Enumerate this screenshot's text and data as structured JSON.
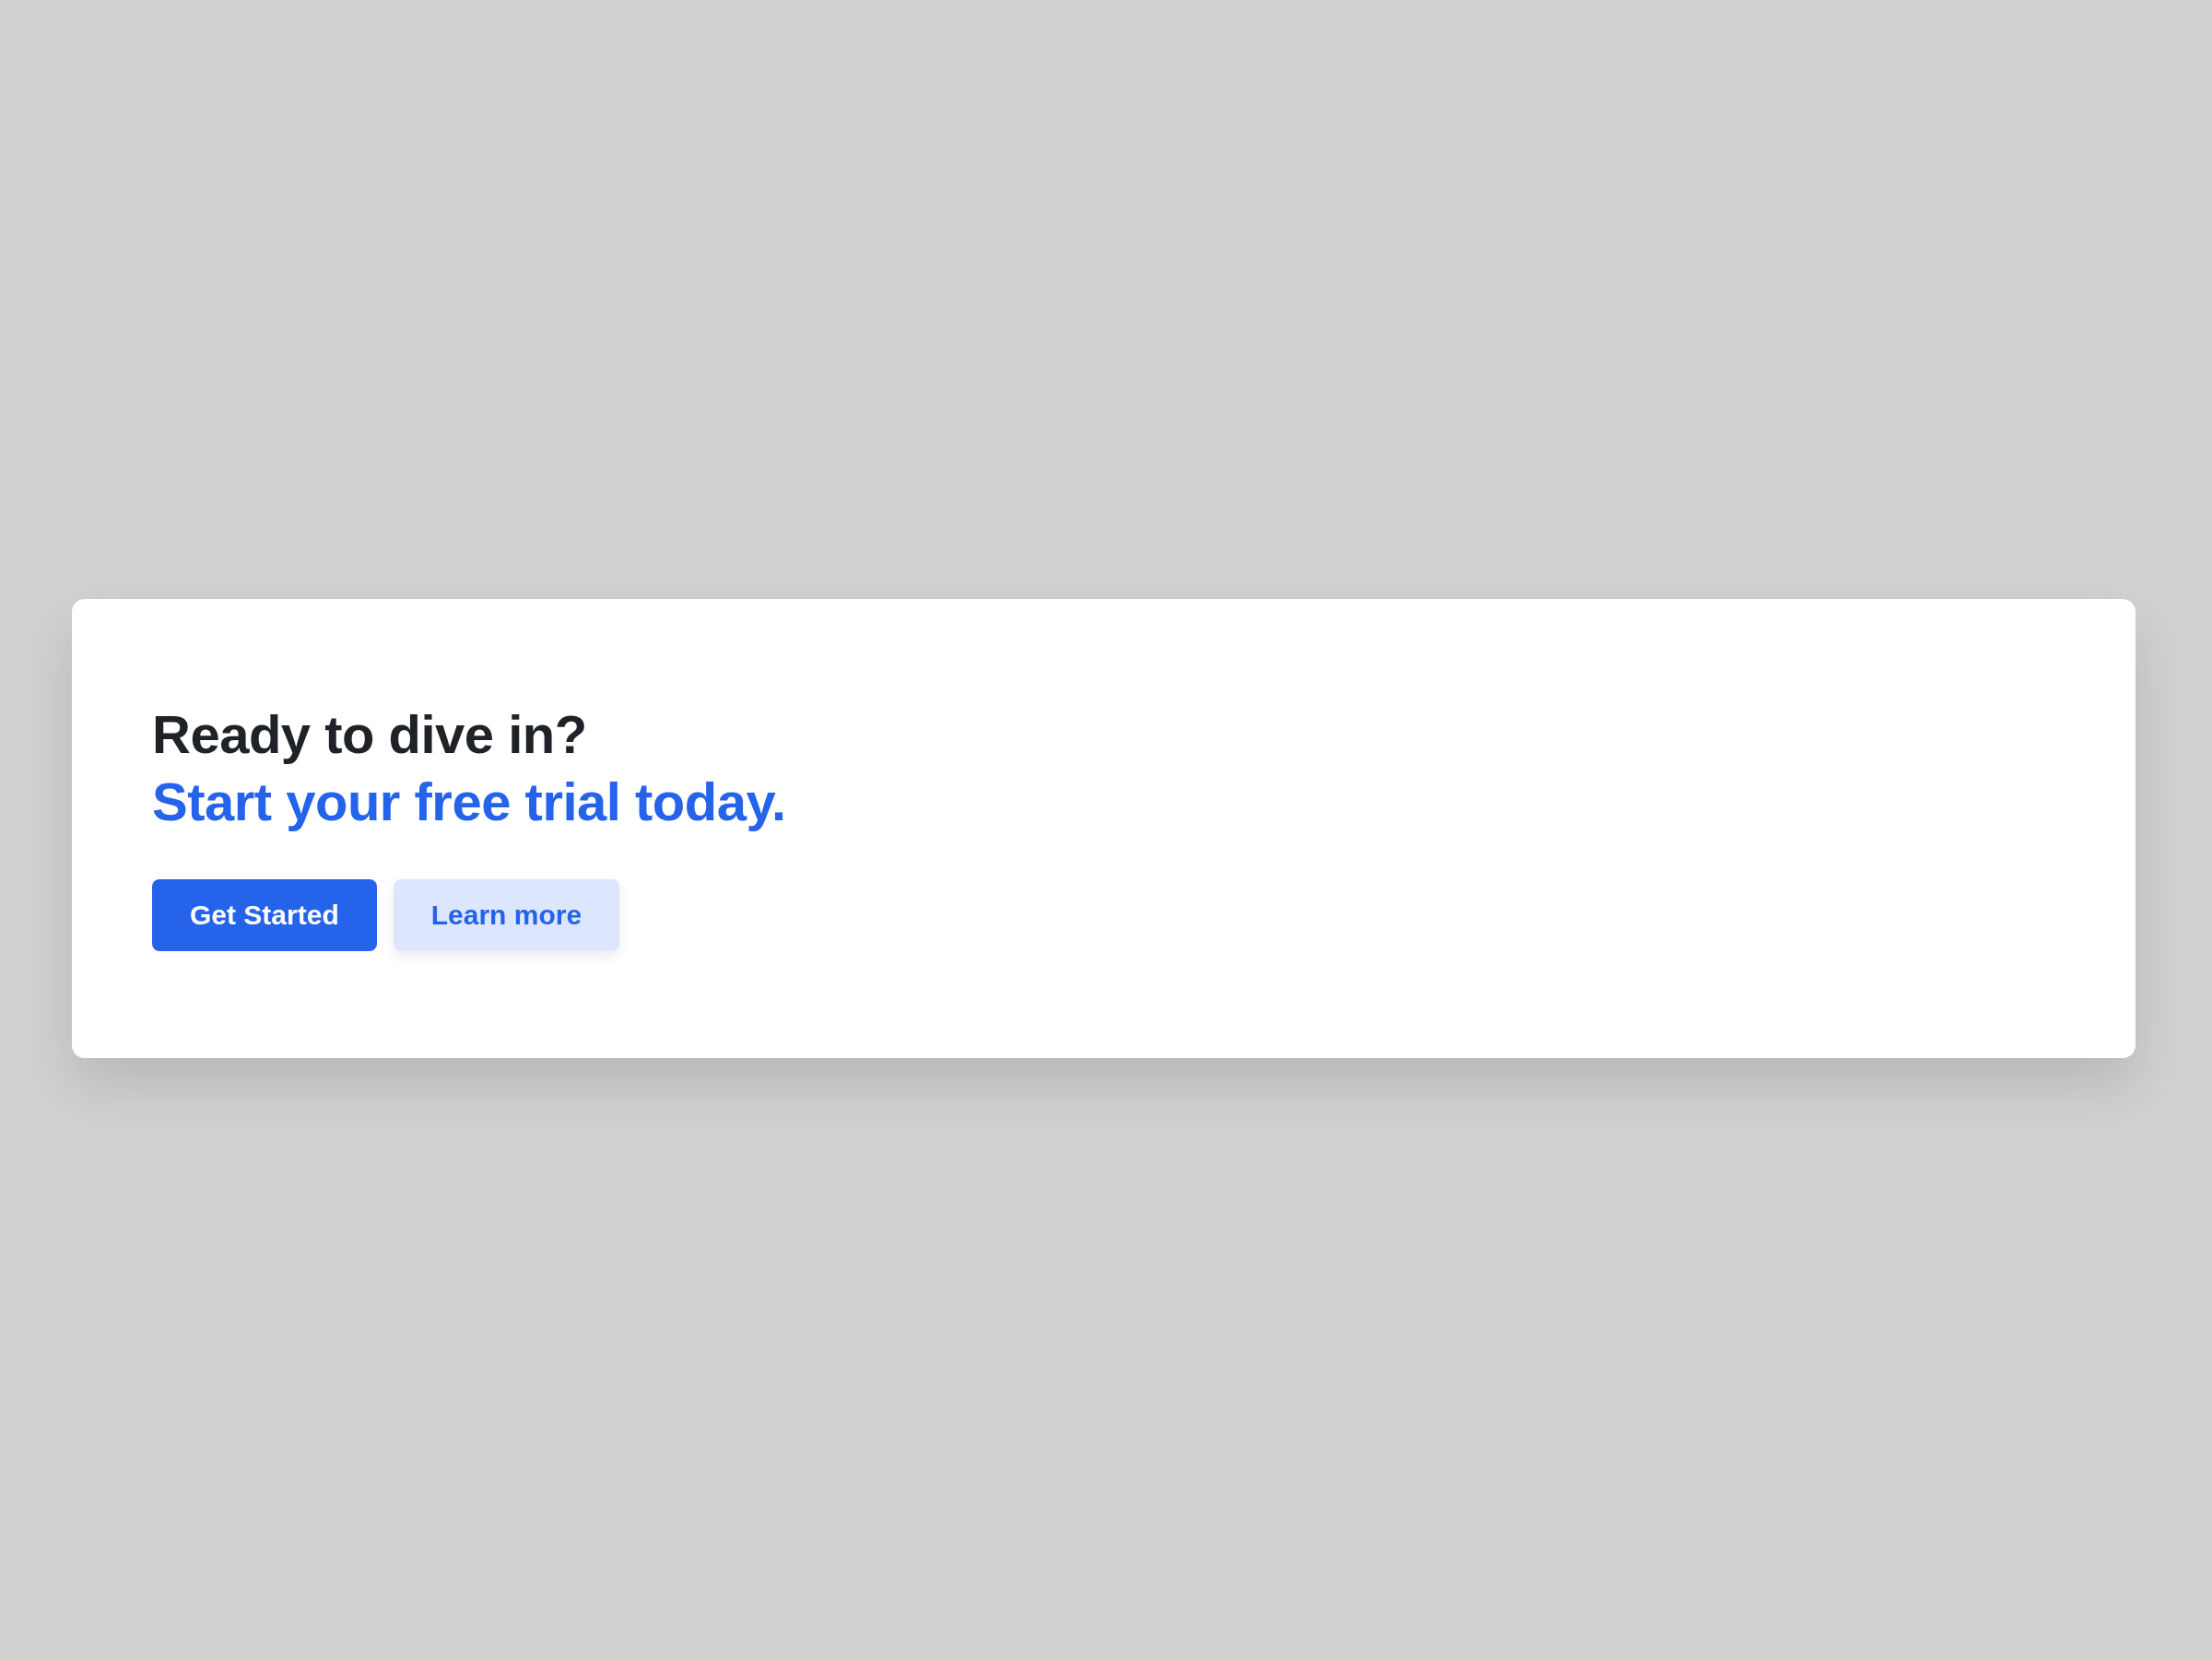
{
  "heading": {
    "line_1": "Ready to dive in?",
    "line_2": "Start your free trial today."
  },
  "buttons": [
    {
      "label": "Get Started",
      "kind": "primary"
    },
    {
      "label": "Learn more",
      "kind": "secondary"
    }
  ]
}
